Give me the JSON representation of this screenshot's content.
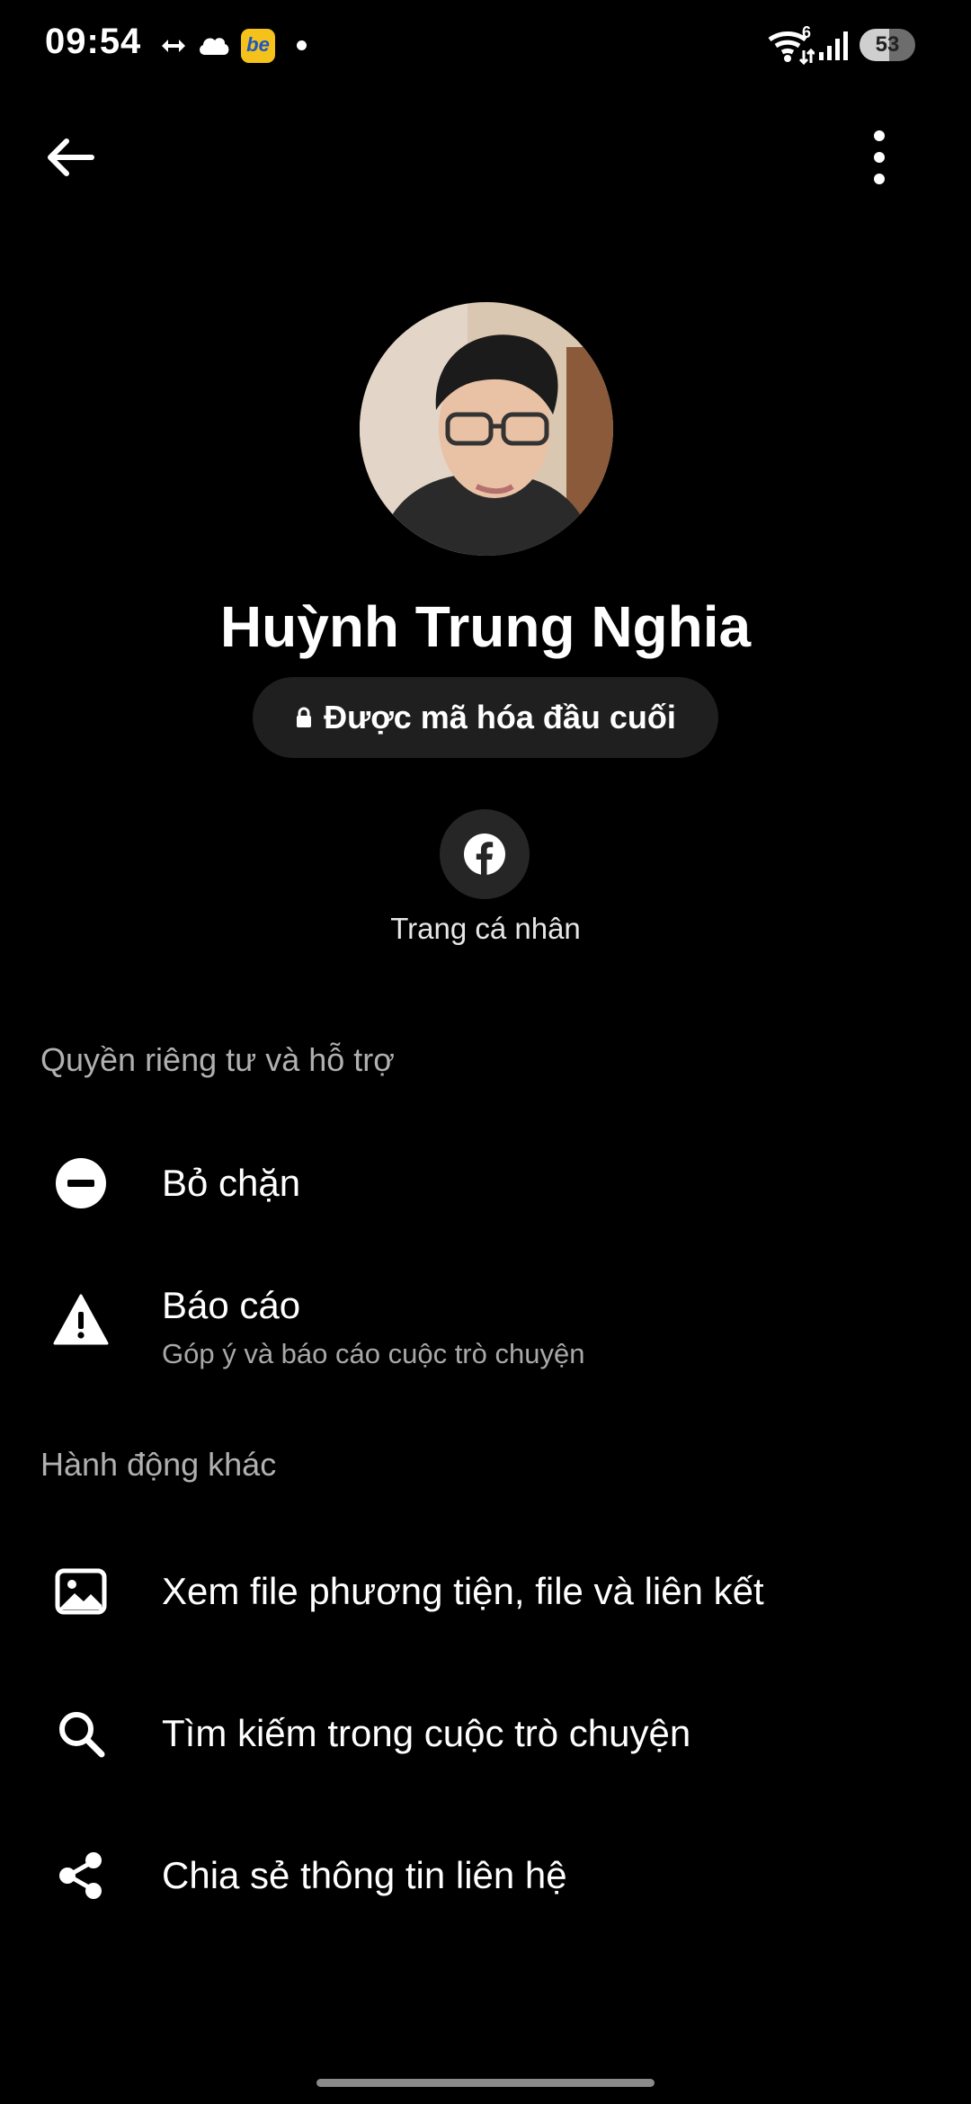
{
  "status_bar": {
    "time": "09:54",
    "battery": "53",
    "wifi_badge": "6",
    "app_badge_text": "be",
    "icons": [
      "sync-arrows-icon",
      "cloud-icon",
      "be-app-icon",
      "notification-dot-icon",
      "wifi-icon",
      "signal-icon",
      "battery-icon"
    ]
  },
  "app_bar": {
    "icons": [
      "back-arrow-icon",
      "more-vertical-icon"
    ]
  },
  "profile": {
    "name": "Huỳnh Trung Nghia",
    "encryption_label": "Được mã hóa đầu cuối",
    "encryption_icon": "lock-icon",
    "facebook_profile_label": "Trang cá nhân",
    "facebook_icon": "facebook-icon"
  },
  "sections": {
    "privacy": {
      "title": "Quyền riêng tư và hỗ trợ",
      "items": [
        {
          "icon": "unblock-icon",
          "label": "Bỏ chặn"
        },
        {
          "icon": "warning-icon",
          "label": "Báo cáo",
          "sublabel": "Góp ý và báo cáo cuộc trò chuyện"
        }
      ]
    },
    "other_actions": {
      "title": "Hành động khác",
      "items": [
        {
          "icon": "image-icon",
          "label": "Xem file phương tiện, file và liên kết"
        },
        {
          "icon": "search-icon",
          "label": "Tìm kiếm trong cuộc trò chuyện"
        },
        {
          "icon": "share-icon",
          "label": "Chia sẻ thông tin liên hệ"
        }
      ]
    }
  },
  "colors": {
    "background": "#000000",
    "pill_background": "#1f1f1f",
    "secondary_text": "#b0b0b0"
  }
}
